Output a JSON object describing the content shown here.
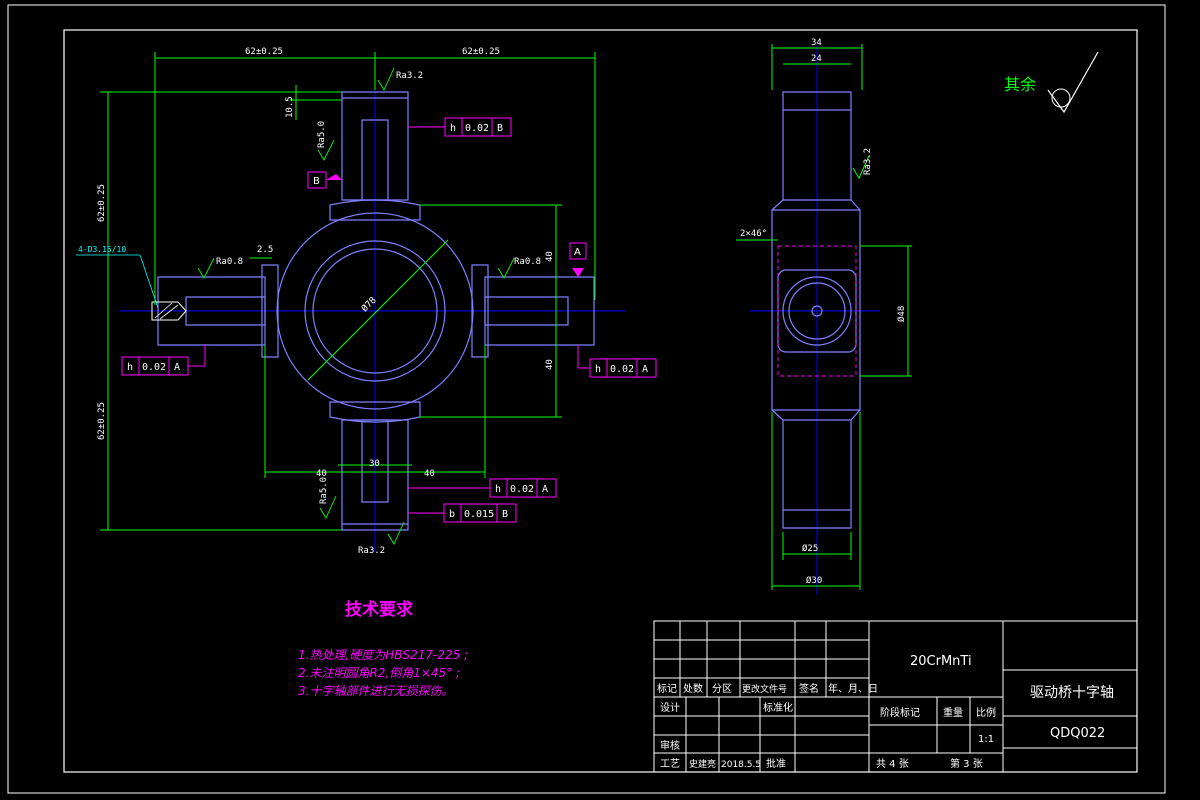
{
  "dimensions": {
    "top_left": "62±0.25",
    "top_right": "62±0.25",
    "left_upper": "62±0.25",
    "left_lower": "62±0.25",
    "shoulder": "10.5",
    "gap": "2.5",
    "right_upper": "40",
    "right_lower": "40",
    "bottom_left": "40",
    "bottom_center": "30",
    "bottom_right": "40",
    "center_dia": "Ø78",
    "side_top_outer": "34",
    "side_top_inner": "24",
    "side_chamfer": "2×46°",
    "side_height": "Ø48",
    "side_bottom_inner": "Ø25",
    "side_bottom_outer": "Ø30",
    "thread": "4-D3.15/10"
  },
  "roughness": {
    "top": "Ra3.2",
    "upper_stem": "Ra5.0",
    "left_arm": "Ra0.8",
    "right_arm": "Ra0.8",
    "lower_stem": "Ra5.0",
    "bottom": "Ra3.2",
    "side": "Ra3.2",
    "rest_label": "其余"
  },
  "datums": {
    "a": "A",
    "b": "B"
  },
  "tolerances": {
    "top": {
      "symbol": "h",
      "value": "0.02",
      "datum": "B"
    },
    "left": {
      "symbol": "h",
      "value": "0.02",
      "datum": "A"
    },
    "right": {
      "symbol": "h",
      "value": "0.02",
      "datum": "A"
    },
    "bottom1": {
      "symbol": "h",
      "value": "0.02",
      "datum": "A"
    },
    "bottom2": {
      "symbol": "b",
      "value": "0.015",
      "datum": "B"
    }
  },
  "tech": {
    "title": "技术要求",
    "line1": "1.热处理,硬度为HBS217-225 ;",
    "line2": "2.未注明圆角R2,倒角1×45° ;",
    "line3": "3.十字轴部件进行无损探伤。"
  },
  "titleblock": {
    "material": "20CrMnTi",
    "part_name": "驱动桥十字轴",
    "drawing_no": "QDQ022",
    "h_mark": "标记",
    "h_count": "处数",
    "h_zone": "分区",
    "h_doc": "更改文件号",
    "h_sign": "签名",
    "h_date": "年、月、日",
    "design": "设计",
    "standard": "标准化",
    "stage": "阶段标记",
    "weight": "重量",
    "scale": "比例",
    "scale_value": "1:1",
    "review": "审核",
    "process": "工艺",
    "process_person": "史建亮",
    "process_date": "2018.5.5",
    "approve": "批准",
    "sheets_total": "共 4 张",
    "sheet_no": "第 3 张"
  },
  "colors": {
    "frame": "#ffffff",
    "outline": "#7f7fff",
    "dimension": "#00ff00",
    "center": "#0000ff",
    "annotation": "#ff00ff",
    "tech_text": "#ff00ff"
  }
}
